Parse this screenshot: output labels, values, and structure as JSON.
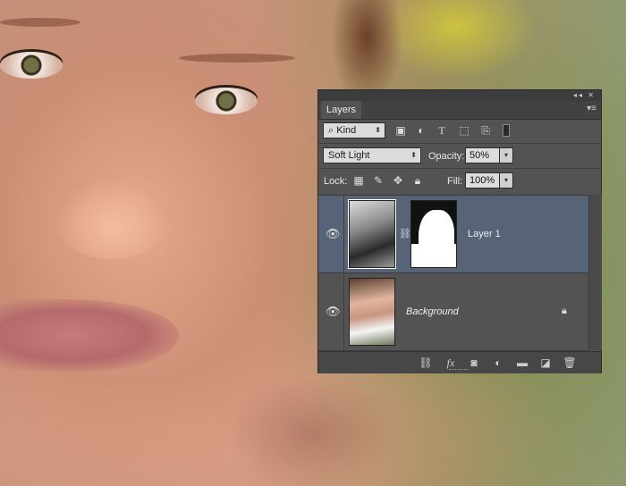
{
  "panel": {
    "tab_label": "Layers",
    "titlebar_buttons": "◂◂ ✕",
    "menu_icon": "panel-menu-icon"
  },
  "filter": {
    "kind_label": "Kind",
    "icons": [
      "filter-pixel-icon",
      "filter-adjustment-icon",
      "filter-type-icon",
      "filter-shape-icon",
      "filter-smart-object-icon",
      "filter-toggle-icon"
    ]
  },
  "blend": {
    "mode": "Soft Light",
    "opacity_label": "Opacity:",
    "opacity_value": "50%"
  },
  "lock": {
    "label": "Lock:",
    "fill_label": "Fill:",
    "fill_value": "100%",
    "icons": [
      "lock-transparent-icon",
      "lock-pixels-icon",
      "lock-position-icon",
      "lock-all-icon"
    ]
  },
  "layers": [
    {
      "name": "Layer 1",
      "selected": true,
      "visible": true,
      "has_mask": true
    },
    {
      "name": "Background",
      "selected": false,
      "visible": true,
      "locked": true
    }
  ],
  "footer_icons": [
    "link-layers-icon",
    "fx-icon",
    "add-mask-icon",
    "adjustment-layer-icon",
    "new-group-icon",
    "new-layer-icon",
    "delete-layer-icon"
  ],
  "colors": {
    "panel_bg": "#535353",
    "selected_layer": "#576377"
  }
}
